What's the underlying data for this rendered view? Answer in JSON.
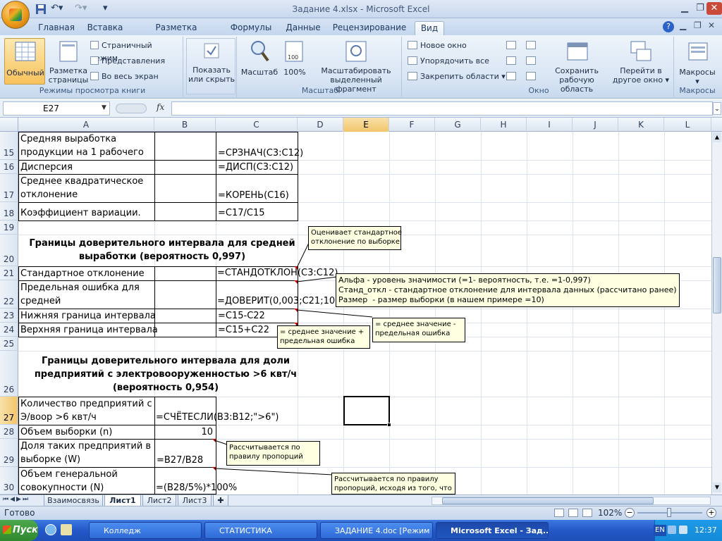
{
  "window": {
    "title": "Задание 4.xlsx - Microsoft Excel"
  },
  "ribbon_tabs": [
    "Главная",
    "Вставка",
    "Разметка страницы",
    "Формулы",
    "Данные",
    "Рецензирование",
    "Вид"
  ],
  "ribbon": {
    "normal": "Обычный",
    "page_layout": "Разметка страницы",
    "page_break": "Страничный режим",
    "views": "Представления",
    "full_screen": "Во весь экран",
    "group_views": "Режимы просмотра книги",
    "show_hide": "Показать или скрыть",
    "zoom": "Масштаб",
    "zoom100": "100%",
    "zoom_selection": "Масштабировать выделенный фрагмент",
    "group_zoom": "Масштаб",
    "new_window": "Новое окно",
    "arrange_all": "Упорядочить все",
    "freeze": "Закрепить области",
    "save_workspace": "Сохранить рабочую область",
    "switch_windows": "Перейти в другое окно",
    "group_window": "Окно",
    "macros": "Макросы",
    "group_macros": "Макросы"
  },
  "namebox": "E27",
  "fx": "fx",
  "columns": [
    "A",
    "B",
    "C",
    "D",
    "E",
    "F",
    "G",
    "H",
    "I",
    "J",
    "K",
    "L"
  ],
  "rows": [
    "15",
    "16",
    "17",
    "18",
    "19",
    "20",
    "21",
    "22",
    "23",
    "24",
    "25",
    "26",
    "27",
    "28",
    "29",
    "30"
  ],
  "cells": {
    "a15": "Средняя выработка продукции на 1 рабочего",
    "c15": "=СРЗНАЧ(C3:C12)",
    "a16": "Дисперсия",
    "c16": "=ДИСП(C3:C12)",
    "a17": "Среднее квадратическое отклонение",
    "c17": "=КОРЕНЬ(C16)",
    "a18": "Коэффициент вариации.",
    "c18": "=C17/C15",
    "h20": "Границы доверительного интервала для средней выработки (вероятность 0,997)",
    "a21": "Стандартное отклонение",
    "c21": "=СТАНДОТКЛОН(C3:C12)",
    "a22": "Предельная ошибка для средней",
    "c22": "=ДОВЕРИТ(0,003;C21;10)",
    "a23": "Нижняя граница интервала",
    "c23": "=C15-C22",
    "a24": "Верхняя граница интервала",
    "c24": "=C15+C22",
    "h26": "Границы доверительного интервала для доли предприятий с электровооруженностью >6 квт/ч (вероятность 0,954)",
    "a27": "Количество предприятий с Э/воор >6 квт/ч",
    "b27": "=СЧЁТЕСЛИ(B3:B12;\">6\")",
    "a28": "Объем выборки (n)",
    "b28": "10",
    "a29": "Доля таких предприятий в выборке (W)",
    "b29": "=B27/B28",
    "a30": "Объем генеральной совокупности (N)",
    "b30": "=(B28/5%)*100%"
  },
  "comments": {
    "c1": "Оценивает стандартное\nотклонение по выборке",
    "c2": "Альфа - уровень значимости (=1- вероятность, т.е. =1-0,997)\nСтанд_откл - стандартное отклонение для интервала данных (рассчитано ранее)\nРазмер  - размер выборки (в нашем примере =10)",
    "c3": "= среднее значение +\nпредельная ошибка",
    "c4": "= среднее значение -\nпредельная ошибка",
    "c5": "Рассчитывается по\nправилу пропорций",
    "c6": "Рассчитывается по правилу\nпропорций, исходя из того, что"
  },
  "sheets": [
    "Взаимосвязь",
    "Лист1",
    "Лист2",
    "Лист3"
  ],
  "status": {
    "ready": "Готово",
    "zoom": "102%"
  },
  "taskbar": {
    "start": "Пуск",
    "tasks": [
      "Колледж",
      "СТАТИСТИКА",
      "ЗАДАНИЕ 4.doc [Режим ...",
      "Microsoft Excel - Зад..."
    ],
    "lang": "EN",
    "time": "12:37"
  },
  "colors": {
    "selected_header": "#f2c56a",
    "comment_bg": "#ffffe1",
    "taskbar": "#2458c8"
  }
}
